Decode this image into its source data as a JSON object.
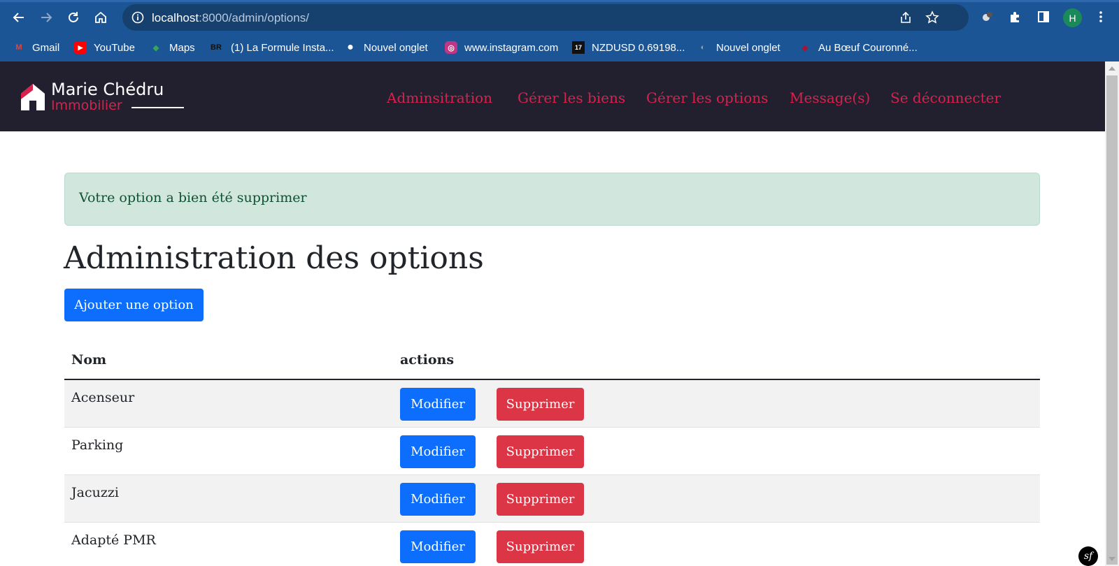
{
  "browser": {
    "url_host": "localhost",
    "url_path": ":8000/admin/options/",
    "profile_initial": "H",
    "bookmarks": [
      {
        "label": "Gmail",
        "icon": "gmail-icon",
        "glyph": "M"
      },
      {
        "label": "YouTube",
        "icon": "youtube-icon",
        "glyph": "▶"
      },
      {
        "label": "Maps",
        "icon": "maps-icon",
        "glyph": "◆"
      },
      {
        "label": "(1) La Formule Insta...",
        "icon": "br-icon",
        "glyph": "BR"
      },
      {
        "label": "Nouvel onglet",
        "icon": "globe-icon",
        "glyph": "●"
      },
      {
        "label": "www.instagram.com",
        "icon": "instagram-icon",
        "glyph": "◎"
      },
      {
        "label": "NZDUSD 0.69198...",
        "icon": "tradingview-icon",
        "glyph": "17"
      },
      {
        "label": "Nouvel onglet",
        "icon": "page-icon",
        "glyph": "◐"
      },
      {
        "label": "Au Bœuf Couronné...",
        "icon": "pin-icon",
        "glyph": "◆"
      }
    ]
  },
  "site": {
    "logo_title": "Marie Chédru",
    "logo_sub": "Immobilier",
    "nav": [
      "Adminsitration",
      "Gérer les biens",
      "Gérer les options",
      "Message(s)",
      "Se déconnecter"
    ]
  },
  "alert": {
    "message": "Votre option a bien été supprimer"
  },
  "page_title": "Administration des options",
  "add_button": "Ajouter une option",
  "table": {
    "headers": {
      "name": "Nom",
      "actions": "actions"
    },
    "edit_label": "Modifier",
    "delete_label": "Supprimer",
    "rows": [
      {
        "name": "Acenseur"
      },
      {
        "name": "Parking"
      },
      {
        "name": "Jacuzzi"
      },
      {
        "name": "Adapté PMR"
      }
    ]
  },
  "debug_badge": "sf",
  "colors": {
    "chrome": "#1c5595",
    "header": "#22202f",
    "accent": "#d6224c",
    "primary": "#0d6efd",
    "danger": "#dc3545",
    "alert_bg": "#d1e7dd"
  }
}
